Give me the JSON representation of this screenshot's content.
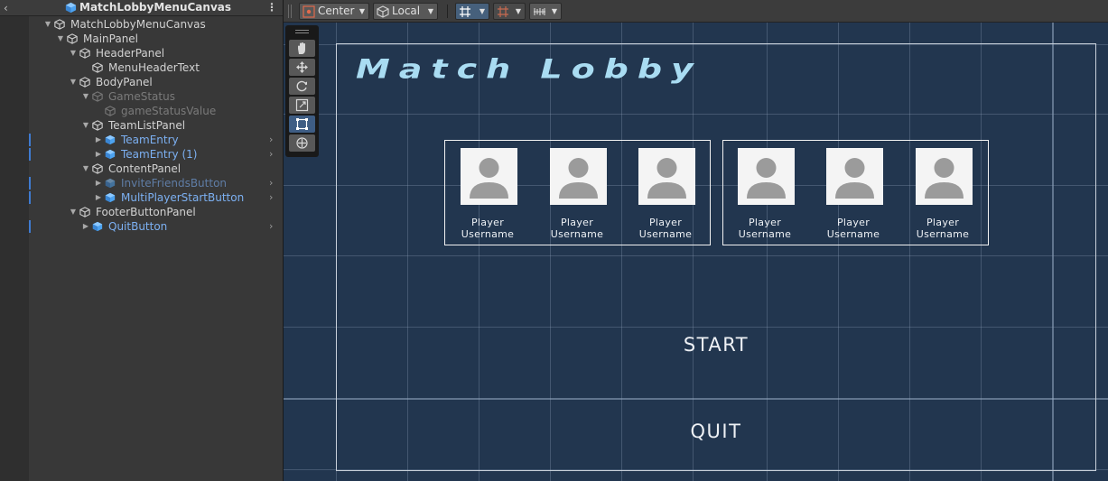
{
  "hierarchy": {
    "title": "MatchLobbyMenuCanvas",
    "back_glyph": "‹",
    "menu_glyph": "⋮",
    "rows": [
      {
        "label": "MatchLobbyMenuCanvas",
        "indent": 0,
        "kind": "normal",
        "expanded": true
      },
      {
        "label": "MainPanel",
        "indent": 1,
        "kind": "normal",
        "expanded": true
      },
      {
        "label": "HeaderPanel",
        "indent": 2,
        "kind": "normal",
        "expanded": true
      },
      {
        "label": "MenuHeaderText",
        "indent": 3,
        "kind": "normal",
        "leaf": true
      },
      {
        "label": "BodyPanel",
        "indent": 2,
        "kind": "normal",
        "expanded": true
      },
      {
        "label": "GameStatus",
        "indent": 3,
        "kind": "dim",
        "expanded": true
      },
      {
        "label": "gameStatusValue",
        "indent": 4,
        "kind": "dim",
        "leaf": true
      },
      {
        "label": "TeamListPanel",
        "indent": 3,
        "kind": "normal",
        "expanded": true
      },
      {
        "label": "TeamEntry",
        "indent": 4,
        "kind": "prefab",
        "collapsed": true,
        "marked": true
      },
      {
        "label": "TeamEntry (1)",
        "indent": 4,
        "kind": "prefab",
        "collapsed": true,
        "marked": true
      },
      {
        "label": "ContentPanel",
        "indent": 3,
        "kind": "normal",
        "expanded": true
      },
      {
        "label": "InviteFriendsButton",
        "indent": 4,
        "kind": "dim-prefab",
        "collapsed": true,
        "marked": true
      },
      {
        "label": "MultiPlayerStartButton",
        "indent": 4,
        "kind": "prefab",
        "collapsed": true,
        "marked": true
      },
      {
        "label": "FooterButtonPanel",
        "indent": 2,
        "kind": "normal",
        "expanded": true
      },
      {
        "label": "QuitButton",
        "indent": 3,
        "kind": "prefab",
        "collapsed": true,
        "marked": true
      }
    ]
  },
  "toolbar": {
    "pivot_label": "Center",
    "space_label": "Local",
    "dropdown_glyph": "▼"
  },
  "scene": {
    "title": "Match Lobby",
    "teams": [
      {
        "players": [
          {
            "line1": "Player",
            "line2": "Username"
          },
          {
            "line1": "Player",
            "line2": "Username"
          },
          {
            "line1": "Player",
            "line2": "Username"
          }
        ]
      },
      {
        "players": [
          {
            "line1": "Player",
            "line2": "Username"
          },
          {
            "line1": "Player",
            "line2": "Username"
          },
          {
            "line1": "Player",
            "line2": "Username"
          }
        ]
      }
    ],
    "start_label": "START",
    "quit_label": "QUIT"
  },
  "colors": {
    "scene_bg": "#22364f",
    "prefab_text": "#7cb0f2",
    "panel_bg": "#383838"
  }
}
